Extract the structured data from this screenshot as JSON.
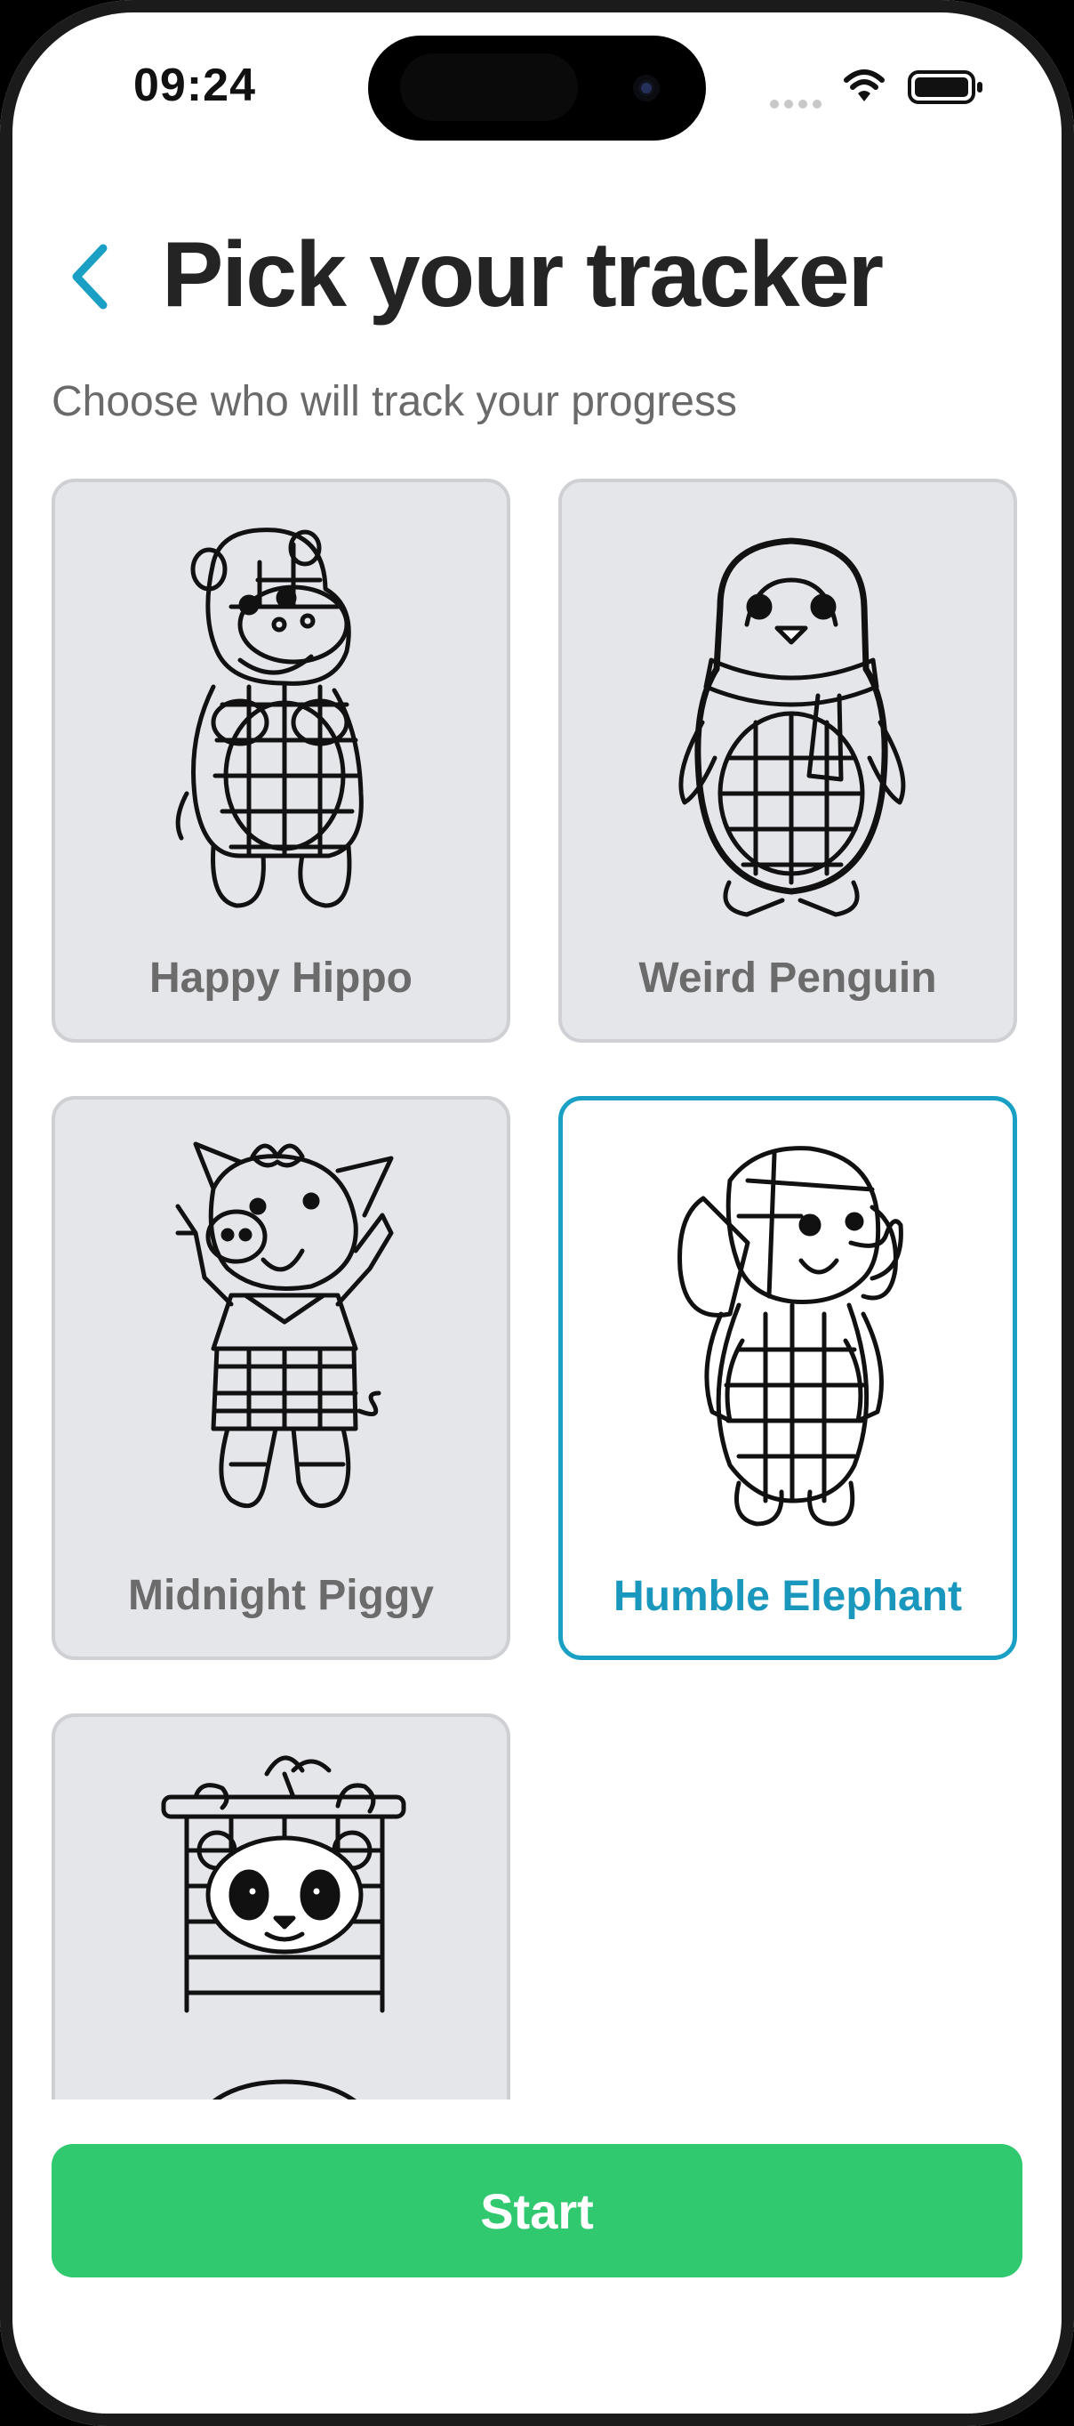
{
  "status_bar": {
    "time": "09:24",
    "icons": [
      "signal-dots-icon",
      "wifi-icon",
      "battery-icon"
    ]
  },
  "header": {
    "back_icon": "chevron-left-icon",
    "title": "Pick your tracker"
  },
  "subtitle": "Choose who will track your progress",
  "trackers": [
    {
      "name": "Happy Hippo",
      "illustration": "hippo-illustration",
      "selected": false
    },
    {
      "name": "Weird Penguin",
      "illustration": "penguin-illustration",
      "selected": false
    },
    {
      "name": "Midnight Piggy",
      "illustration": "pig-illustration",
      "selected": false
    },
    {
      "name": "Humble Elephant",
      "illustration": "elephant-illustration",
      "selected": true
    },
    {
      "name": "",
      "illustration": "panda-illustration",
      "selected": false
    }
  ],
  "start_button": {
    "label": "Start"
  },
  "colors": {
    "accent": "#1aa0c4",
    "primary_button": "#30c970",
    "card_background": "#e5e6ea",
    "card_border": "#cfd0d4",
    "title_text": "#242424"
  }
}
